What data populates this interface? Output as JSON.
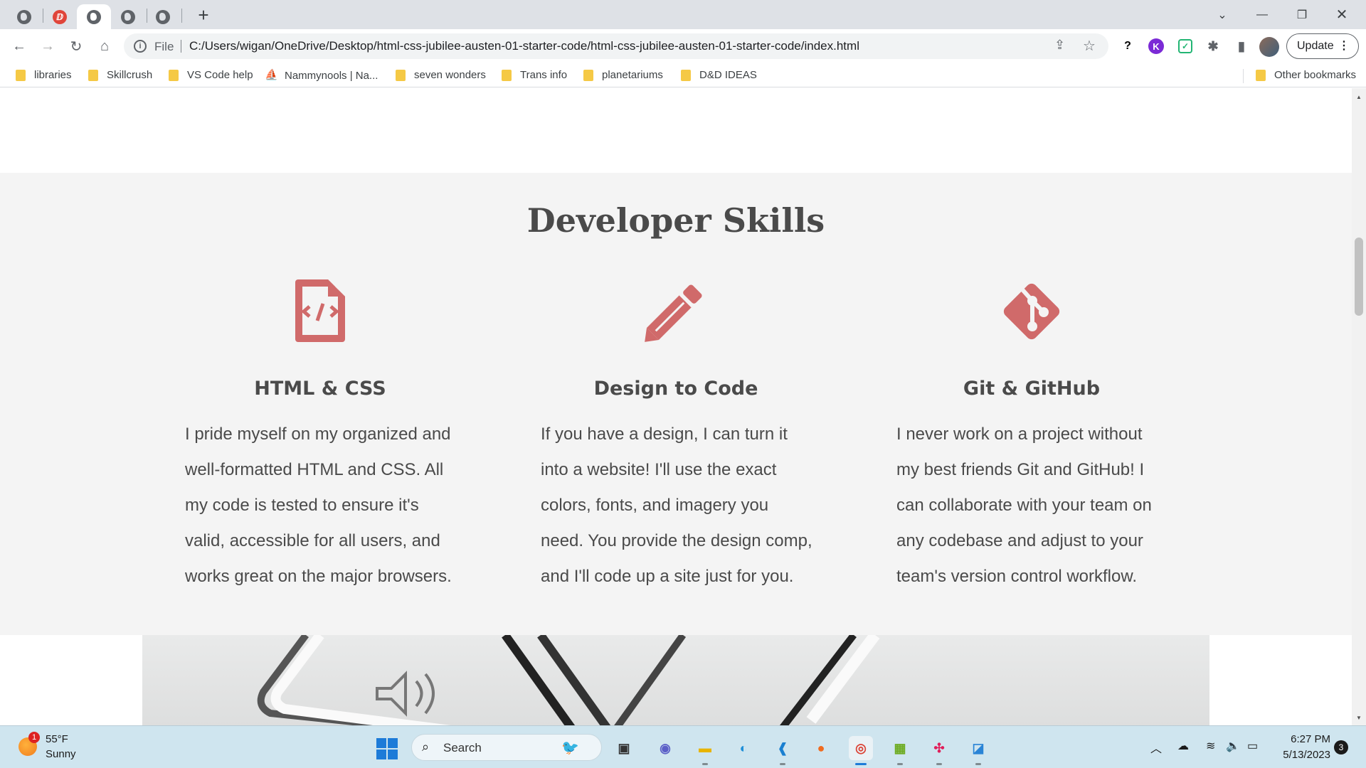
{
  "browser": {
    "tabs": [
      {
        "icon": "globe-icon",
        "active": false
      },
      {
        "icon": "pdf-icon",
        "active": false
      },
      {
        "icon": "globe-icon",
        "active": true
      },
      {
        "icon": "globe-icon",
        "active": false
      },
      {
        "icon": "globe-icon",
        "active": false
      }
    ],
    "new_tab": "+",
    "address": {
      "scheme_label": "File",
      "url": "C:/Users/wigan/OneDrive/Desktop/html-css-jubilee-austen-01-starter-code/html-css-jubilee-austen-01-starter-code/index.html"
    },
    "extensions": {
      "k_label": "K",
      "update_label": "Update"
    },
    "bookmarks": [
      {
        "label": "libraries",
        "icon": "folder-icon"
      },
      {
        "label": "Skillcrush",
        "icon": "folder-icon"
      },
      {
        "label": "VS Code help",
        "icon": "folder-icon"
      },
      {
        "label": "Nammynools | Na...",
        "icon": "site-icon"
      },
      {
        "label": "seven wonders",
        "icon": "folder-icon"
      },
      {
        "label": "Trans info",
        "icon": "folder-icon"
      },
      {
        "label": "planetariums",
        "icon": "folder-icon"
      },
      {
        "label": "D&D IDEAS",
        "icon": "folder-icon"
      }
    ],
    "other_bookmarks": "Other bookmarks"
  },
  "page": {
    "accent_color": "#d06a6a",
    "section_title": "Developer Skills",
    "skills": [
      {
        "icon": "file-code-icon",
        "title": "HTML & CSS",
        "lines": [
          "I pride myself on my organized and",
          "well-formatted HTML and CSS. All",
          "my code is tested to ensure it's",
          "valid, accessible for all users, and",
          "works great on the major browsers."
        ]
      },
      {
        "icon": "pencil-icon",
        "title": "Design to Code",
        "lines": [
          "If you have a design, I can turn it",
          "into a website! I'll use the exact",
          "colors, fonts, and imagery you",
          "need. You provide the design comp,",
          "and I'll code up a site just for you."
        ]
      },
      {
        "icon": "git-icon",
        "title": "Git & GitHub",
        "lines": [
          "I never work on a project without",
          "my best friends Git and GitHub! I",
          "can collaborate with your team on",
          "any codebase and adjust to your",
          "team's version control workflow."
        ]
      }
    ]
  },
  "taskbar": {
    "weather": {
      "temp": "55°F",
      "desc": "Sunny",
      "badge": "1"
    },
    "search_label": "Search",
    "clock": {
      "time": "6:27 PM",
      "date": "5/13/2023"
    },
    "notification_count": "3"
  }
}
